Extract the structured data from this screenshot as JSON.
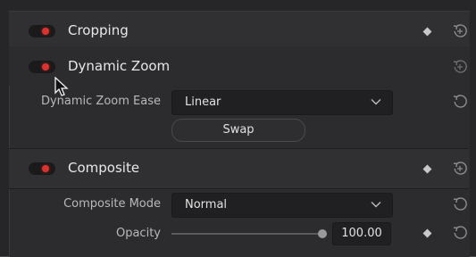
{
  "cropping": {
    "title": "Cropping",
    "toggle_on": true
  },
  "dynamic_zoom": {
    "title": "Dynamic Zoom",
    "toggle_on": true,
    "ease_label": "Dynamic Zoom Ease",
    "ease_value": "Linear",
    "swap_label": "Swap"
  },
  "composite": {
    "title": "Composite",
    "toggle_on": true,
    "mode_label": "Composite Mode",
    "mode_value": "Normal",
    "opacity_label": "Opacity",
    "opacity_value": "100.00",
    "opacity_fraction": 1.0
  },
  "icons": {
    "keyframe": "keyframe-diamond-icon",
    "reset": "reset-icon",
    "chevron": "chevron-down-icon"
  },
  "colors": {
    "toggle_on": "#e0302a",
    "panel_bg": "#2c2c2f"
  }
}
